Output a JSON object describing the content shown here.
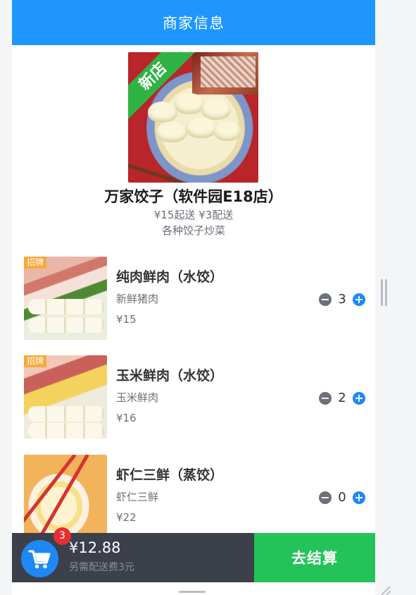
{
  "header": {
    "title": "商家信息"
  },
  "shop": {
    "ribbon": "新店",
    "name": "万家饺子（软件园E18店）",
    "delivery": "¥15起送 ¥3配送",
    "tagline": "各种饺子炒菜"
  },
  "dishes": [
    {
      "tag": "招牌",
      "name": "纯肉鲜肉（水饺）",
      "desc": "新鲜猪肉",
      "price": "¥15",
      "count": "3"
    },
    {
      "tag": "招牌",
      "name": "玉米鲜肉（水饺）",
      "desc": "玉米鲜肉",
      "price": "¥16",
      "count": "2"
    },
    {
      "tag": "",
      "name": "虾仁三鲜（蒸饺）",
      "desc": "虾仁三鲜",
      "price": "¥22",
      "count": "0"
    }
  ],
  "stepper": {
    "minus_symbol": "−",
    "plus_symbol": "+"
  },
  "cart": {
    "badge_count": "3",
    "total": "¥12.88",
    "note": "另需配送费3元",
    "checkout_label": "去结算",
    "icon": "shopping-cart-icon"
  },
  "colors": {
    "header": "#1e96fe",
    "checkout": "#24c35a",
    "cart_bar": "#3b404a",
    "plus": "#1e88f5",
    "badge": "#e62f2f",
    "brand_tag": "#f6a93b",
    "new_ribbon": "#2fb344"
  }
}
